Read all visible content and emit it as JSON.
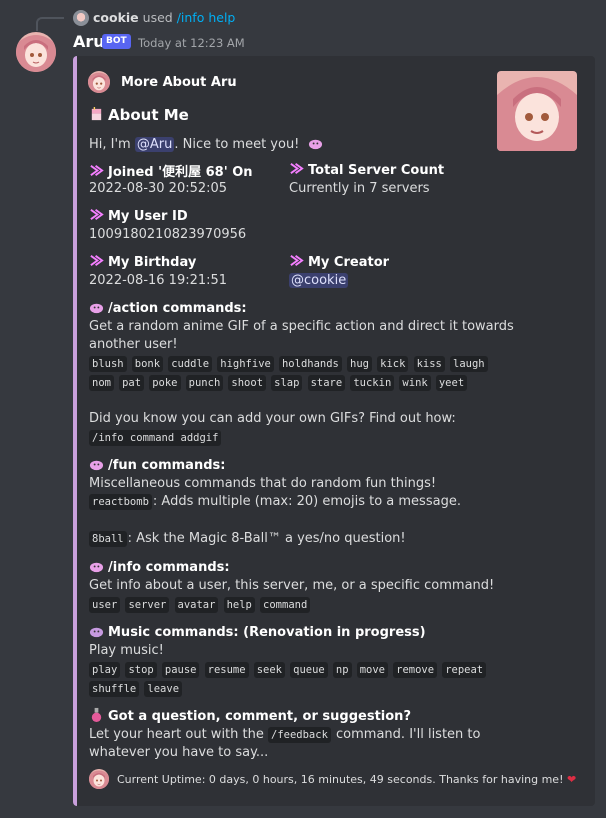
{
  "reply": {
    "user": "cookie",
    "used": "used",
    "command": "/info help"
  },
  "message": {
    "username": "Aru",
    "bot_tag": "BOT",
    "timestamp": "Today at 12:23 AM"
  },
  "embed": {
    "author": "More About Aru",
    "title": "About Me",
    "intro_pre": "Hi, I'm ",
    "intro_mention": "@Aru",
    "intro_post": ". Nice to meet you!",
    "fields": {
      "joined": {
        "name": "Joined '便利屋 68' On",
        "value": "2022-08-30 20:52:05"
      },
      "servers": {
        "name": "Total Server Count",
        "value": "Currently in 7 servers"
      },
      "userid": {
        "name": "My User ID",
        "value": "1009180210823970956"
      },
      "birthday": {
        "name": "My Birthday",
        "value": "2022-08-16 19:21:51"
      },
      "creator": {
        "name": "My Creator",
        "value": "@cookie"
      }
    },
    "action": {
      "heading": "/action commands:",
      "desc1": "Get a random anime GIF of a specific action and direct it towards",
      "desc2": "another user!",
      "row1": [
        "blush",
        "bonk",
        "cuddle",
        "highfive",
        "holdhands",
        "hug",
        "kick",
        "kiss",
        "laugh"
      ],
      "row2": [
        "nom",
        "pat",
        "poke",
        "punch",
        "shoot",
        "slap",
        "stare",
        "tuckin",
        "wink",
        "yeet"
      ],
      "gif_note": "Did you know you can add your own GIFs? Find out how:",
      "gif_cmd": "/info command addgif"
    },
    "fun": {
      "heading": "/fun commands:",
      "desc": "Miscellaneous commands that do random fun things!",
      "reactbomb_cmd": "reactbomb",
      "reactbomb_desc": ": Adds multiple (max: 20) emojis to a message.",
      "ball_cmd": "8ball",
      "ball_desc": ": Ask the Magic 8-Ball™ a yes/no question!"
    },
    "info": {
      "heading": "/info commands:",
      "desc": "Get info about a user, this server, me, or a specific command!",
      "cmds": [
        "user",
        "server",
        "avatar",
        "help",
        "command"
      ]
    },
    "music": {
      "heading": "Music commands: (Renovation in progress)",
      "desc": "Play music!",
      "row1": [
        "play",
        "stop",
        "pause",
        "resume",
        "seek",
        "queue",
        "np",
        "move",
        "remove",
        "repeat"
      ],
      "row2": [
        "shuffle",
        "leave"
      ]
    },
    "feedback": {
      "heading": "Got a question, comment, or suggestion?",
      "pre": "Let your heart out with the ",
      "cmd": "/feedback",
      "post": " command. I'll listen to",
      "line2": "whatever you have to say..."
    },
    "footer": "Current Uptime: 0 days, 0 hours, 16 minutes, 49 seconds. Thanks for having me!"
  },
  "colors": {
    "embed_accent": "#c9a0dc",
    "link": "#00aff4",
    "bot_tag": "#5865f2",
    "heart": "#dd2e44"
  },
  "icons": [
    "sparkle-arrow-icon",
    "cake-icon",
    "blob-emoji-icon",
    "heart-icon"
  ]
}
